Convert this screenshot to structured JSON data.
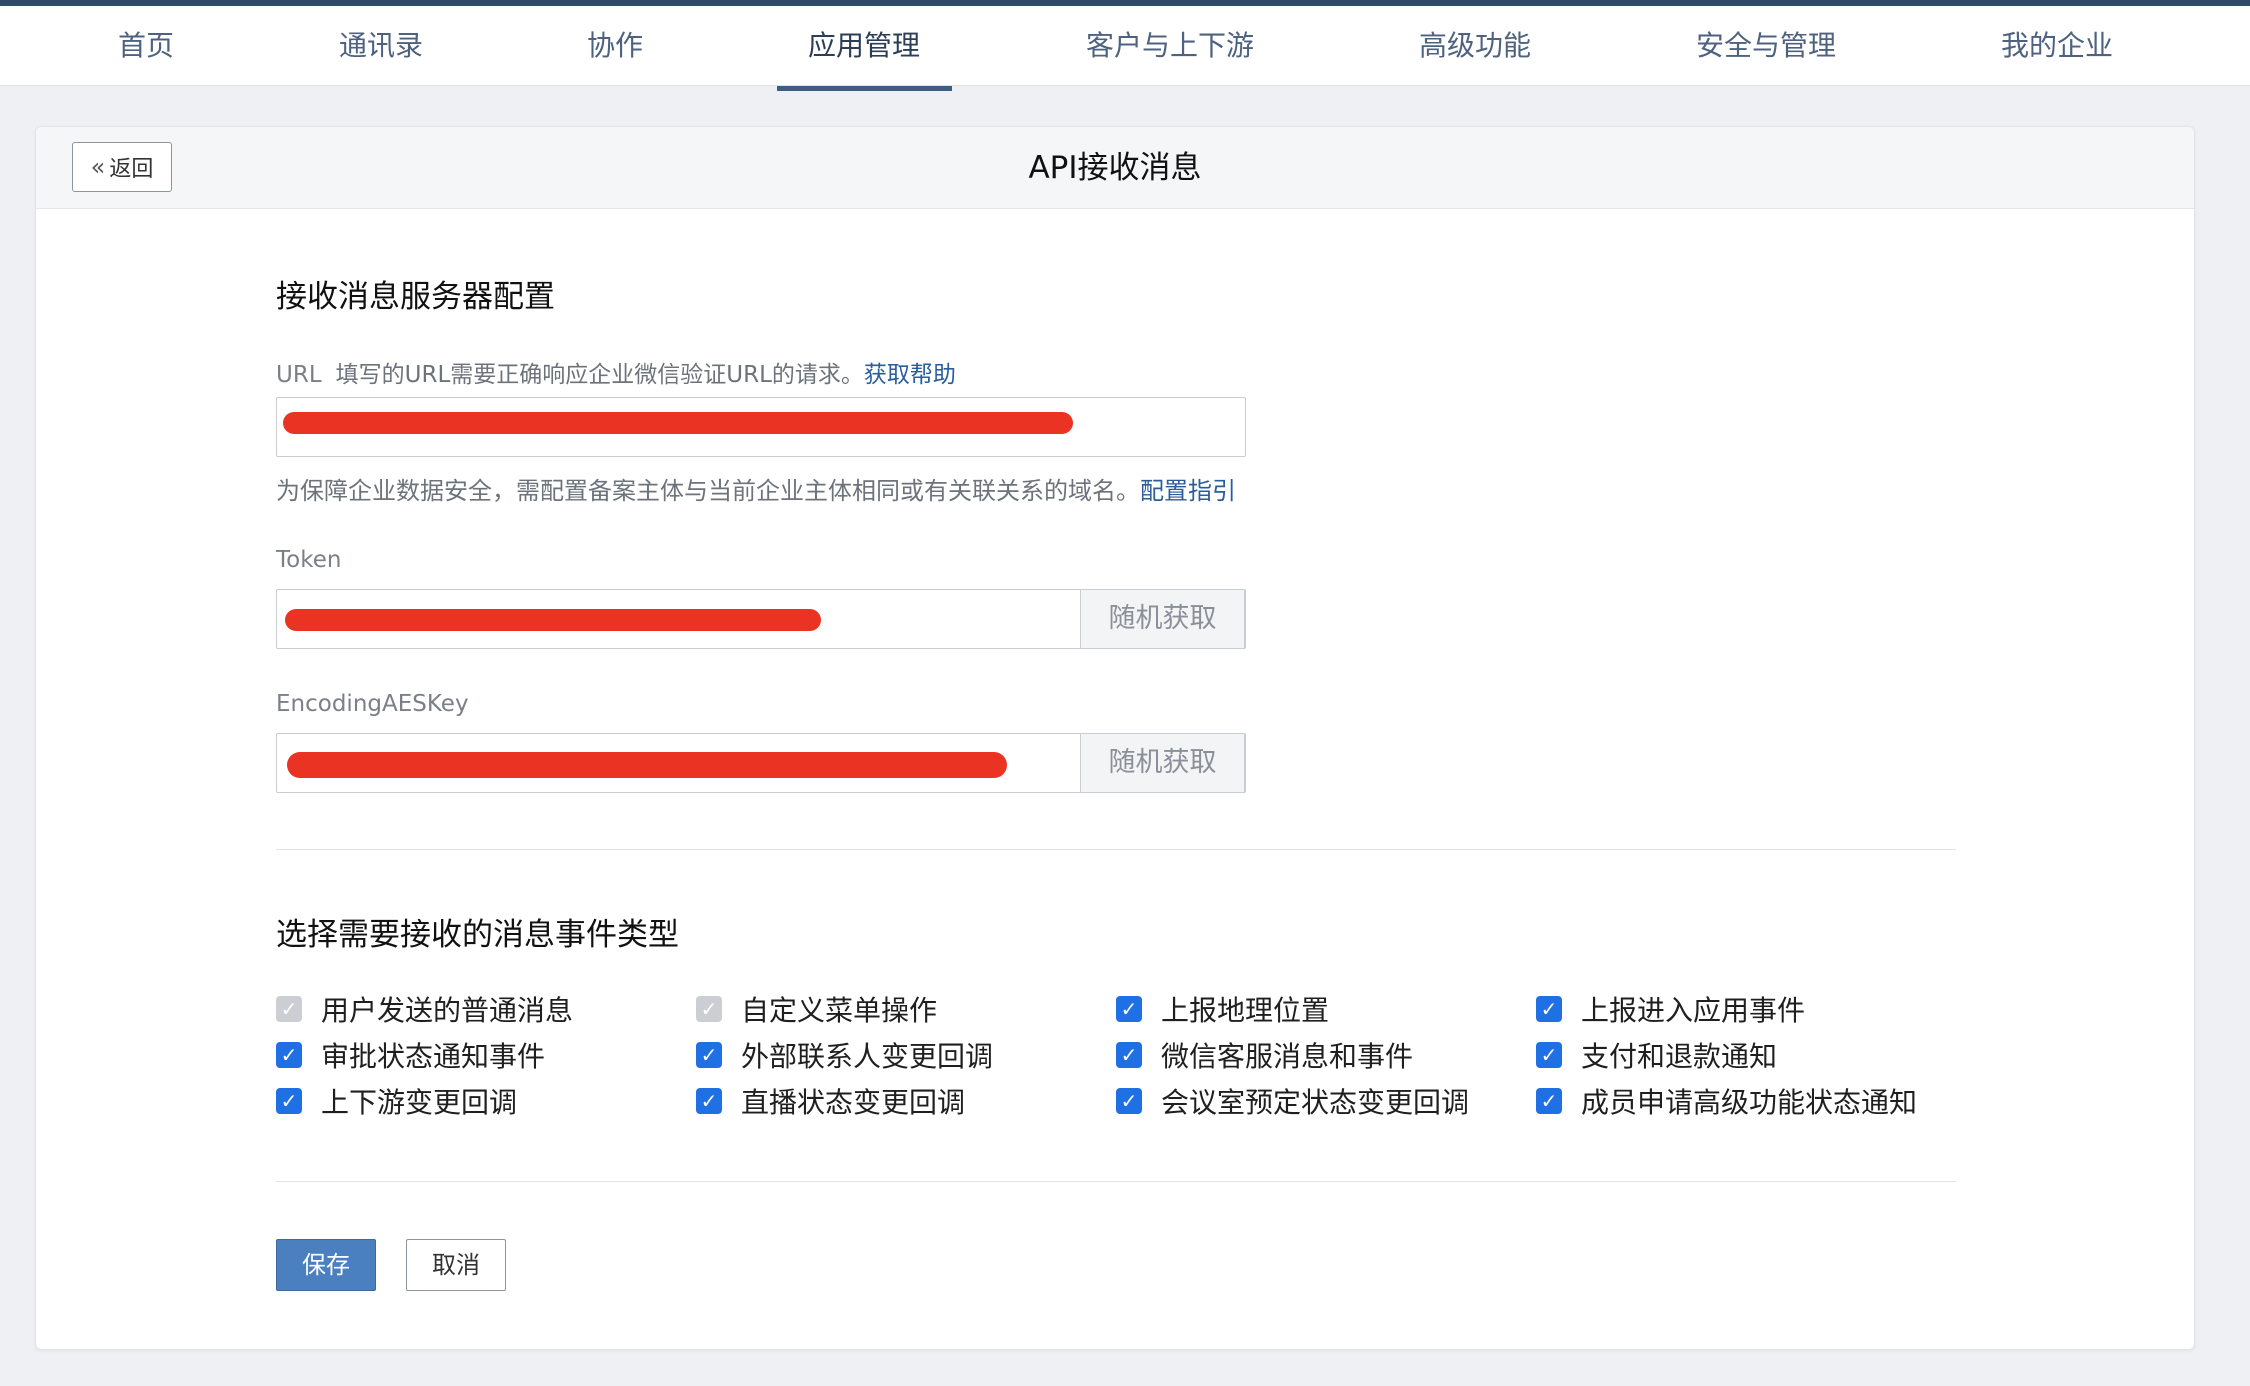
{
  "nav": {
    "items": [
      "首页",
      "通讯录",
      "协作",
      "应用管理",
      "客户与上下游",
      "高级功能",
      "安全与管理",
      "我的企业"
    ],
    "active": "应用管理"
  },
  "header": {
    "back_label": "返回",
    "back_icon": "double-chevron-left-icon",
    "title": "API接收消息"
  },
  "server_config": {
    "title": "接收消息服务器配置",
    "url": {
      "label": "URL",
      "description": "填写的URL需要正确响应企业微信验证URL的请求。",
      "help_link": "获取帮助",
      "value_redacted": true
    },
    "url_hint": "为保障企业数据安全，需配置备案主体与当前企业主体相同或有关联关系的域名。",
    "url_hint_link": "配置指引",
    "token": {
      "label": "Token",
      "random_button": "随机获取",
      "value_redacted": true
    },
    "aes_key": {
      "label": "EncodingAESKey",
      "random_button": "随机获取",
      "value_redacted": true
    }
  },
  "events": {
    "title": "选择需要接收的消息事件类型",
    "items": [
      {
        "label": "用户发送的普通消息",
        "checked": true,
        "disabled": true
      },
      {
        "label": "自定义菜单操作",
        "checked": true,
        "disabled": true
      },
      {
        "label": "上报地理位置",
        "checked": true,
        "disabled": false
      },
      {
        "label": "上报进入应用事件",
        "checked": true,
        "disabled": false
      },
      {
        "label": "审批状态通知事件",
        "checked": true,
        "disabled": false
      },
      {
        "label": "外部联系人变更回调",
        "checked": true,
        "disabled": false
      },
      {
        "label": "微信客服消息和事件",
        "checked": true,
        "disabled": false
      },
      {
        "label": "支付和退款通知",
        "checked": true,
        "disabled": false
      },
      {
        "label": "上下游变更回调",
        "checked": true,
        "disabled": false
      },
      {
        "label": "直播状态变更回调",
        "checked": true,
        "disabled": false
      },
      {
        "label": "会议室预定状态变更回调",
        "checked": true,
        "disabled": false
      },
      {
        "label": "成员申请高级功能状态通知",
        "checked": true,
        "disabled": false
      }
    ]
  },
  "actions": {
    "save": "保存",
    "cancel": "取消"
  },
  "colors": {
    "nav_text": "#4e6280",
    "nav_active_bar": "#3d5c86",
    "link": "#2b5d9a",
    "checkbox_checked": "#1f6fe5",
    "checkbox_disabled": "#cbced3",
    "redaction": "#ea3323",
    "save_button": "#4a7fc0"
  }
}
